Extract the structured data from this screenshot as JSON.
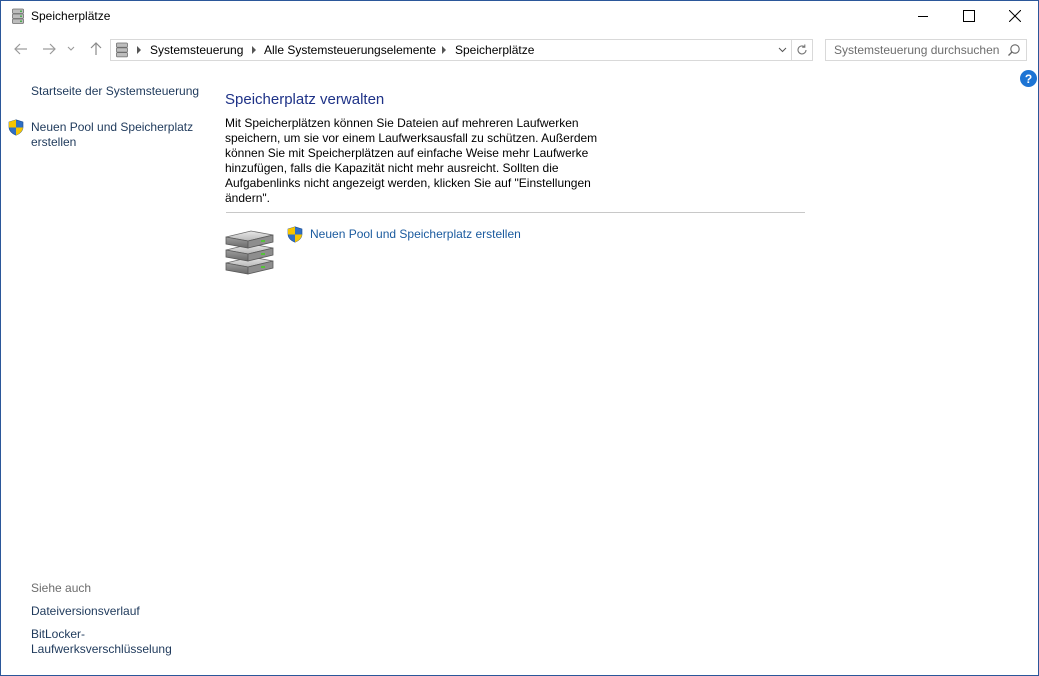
{
  "window": {
    "title": "Speicherplätze"
  },
  "navigation": {
    "breadcrumbs": [
      "Systemsteuerung",
      "Alle Systemsteuerungselemente",
      "Speicherplätze"
    ],
    "search_placeholder": "Systemsteuerung durchsuchen"
  },
  "left_pane": {
    "home_link": "Startseite der Systemsteuerung",
    "create_pool_link": "Neuen Pool und Speicherplatz erstellen",
    "see_also_heading": "Siehe auch",
    "see_also_links": [
      "Dateiversionsverlauf",
      "BitLocker-Laufwerksverschlüsselung"
    ]
  },
  "main": {
    "title": "Speicherplatz verwalten",
    "description": "Mit Speicherplätzen können Sie Dateien auf mehreren Laufwerken speichern, um sie vor einem Laufwerksausfall zu schützen. Außerdem können Sie mit Speicherplätzen auf einfache Weise mehr Laufwerke hinzufügen, falls die Kapazität nicht mehr ausreicht. Sollten die Aufgabenlinks nicht angezeigt werden, klicken Sie auf \"Einstellungen ändern\".",
    "create_pool_link": "Neuen Pool und Speicherplatz erstellen"
  },
  "help": {
    "label": "?"
  },
  "icons": {
    "title": "storage-spaces-icon",
    "shield": "uac-shield-icon",
    "drives": "drive-stack-icon"
  },
  "colors": {
    "link": "#1a5a9e",
    "heading": "#1e3287",
    "window_border": "#2b579a"
  }
}
